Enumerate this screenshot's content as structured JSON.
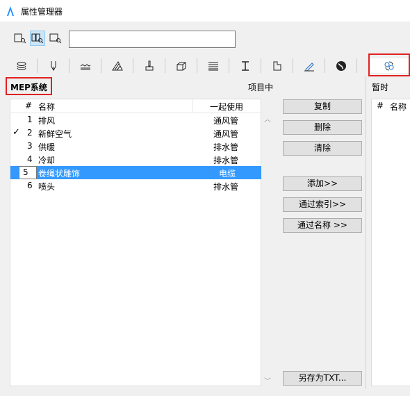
{
  "window": {
    "title": "属性管理器"
  },
  "search": {
    "value": ""
  },
  "tabs": [
    {
      "icon": "layers-icon"
    },
    {
      "icon": "pen-icon"
    },
    {
      "icon": "fill-icon"
    },
    {
      "icon": "surface-icon"
    },
    {
      "icon": "brush-icon"
    },
    {
      "icon": "building-material-icon"
    },
    {
      "icon": "hatch-icon"
    },
    {
      "icon": "profile-icon"
    },
    {
      "icon": "zone-icon"
    },
    {
      "icon": "pen-set-icon"
    },
    {
      "icon": "globe-icon"
    },
    {
      "icon": "mep-system-icon"
    }
  ],
  "left": {
    "title": "MEP系统",
    "section_label": "项目中",
    "columns": {
      "hash": "#",
      "name": "名称",
      "used_with": "一起使用"
    },
    "rows": [
      {
        "num": "1",
        "name": "排风",
        "used_with": "通风管",
        "checked": ""
      },
      {
        "num": "2",
        "name": "新鲜空气",
        "used_with": "通风管",
        "checked": "✓"
      },
      {
        "num": "3",
        "name": "供暖",
        "used_with": "排水管",
        "checked": ""
      },
      {
        "num": "4",
        "name": "冷却",
        "used_with": "排水管",
        "checked": ""
      },
      {
        "num": "5",
        "name": "卷绳状雕饰",
        "used_with": "电缆",
        "checked": ""
      },
      {
        "num": "6",
        "name": "喷头",
        "used_with": "排水管",
        "checked": ""
      }
    ]
  },
  "buttons": {
    "copy": "复制",
    "delete": "删除",
    "clear": "清除",
    "add": "添加>>",
    "by_index": "通过索引>>",
    "by_name": "通过名称 >>",
    "save_txt": "另存为TXT..."
  },
  "right": {
    "title": "暂时",
    "columns": {
      "hash": "#",
      "name": "名称"
    }
  },
  "colors": {
    "selection": "#3399ff",
    "highlight": "#e02020"
  }
}
